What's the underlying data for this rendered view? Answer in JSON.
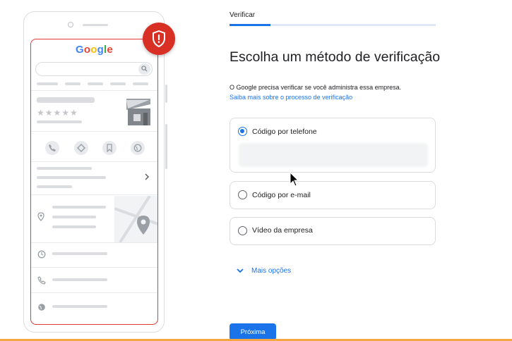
{
  "illustration": {
    "logo_text": "Google",
    "stars": "★★★★★"
  },
  "header": {
    "step_label": "Verificar",
    "progress_fraction": 0.2
  },
  "main": {
    "title": "Escolha um método de verificação",
    "intro": "O Google precisa verificar se você administra essa empresa.",
    "learn_more": "Saiba mais sobre o processo de verificação"
  },
  "options": [
    {
      "label": "Código por telefone",
      "selected": true
    },
    {
      "label": "Código por e-mail",
      "selected": false
    },
    {
      "label": "Vídeo da empresa",
      "selected": false
    }
  ],
  "more_options": "Mais opções",
  "next_button": "Próxima",
  "colors": {
    "accent": "#1a73e8",
    "alert_red": "#d93025",
    "frame_red": "#e53935",
    "bottom_rule": "#f4a742"
  }
}
